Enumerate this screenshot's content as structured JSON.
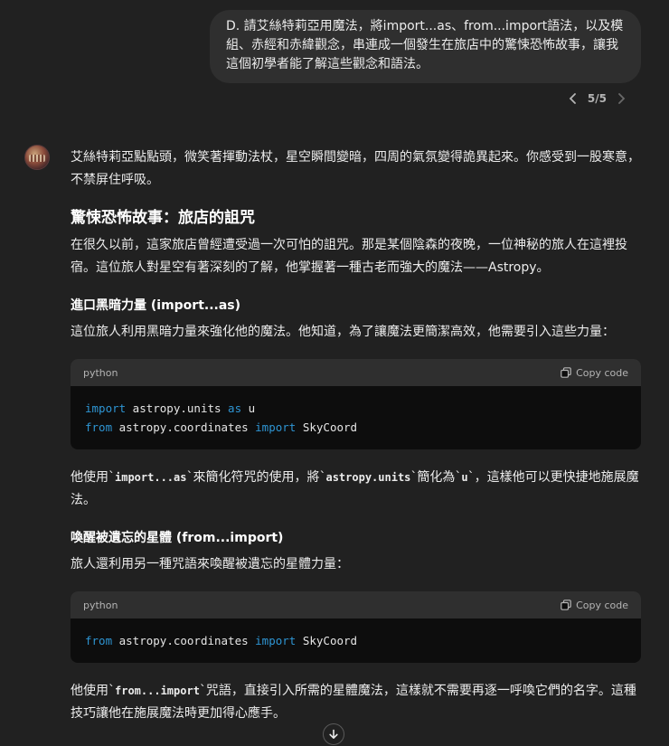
{
  "user_message": {
    "text": "D. 請艾絲特莉亞用魔法，將import...as、from...import語法，以及模組、赤經和赤緯觀念，串連成一個發生在旅店中的驚悚恐怖故事，讓我這個初學者能了解這些觀念和語法。"
  },
  "pager": {
    "label": "5/5"
  },
  "assistant": {
    "intro": "艾絲特莉亞點點頭，微笑著揮動法杖，星空瞬間變暗，四周的氣氛變得詭異起來。你感受到一股寒意，不禁屏住呼吸。",
    "title": "驚悚恐怖故事：旅店的詛咒",
    "para1": "在很久以前，這家旅店曾經遭受過一次可怕的詛咒。那是某個陰森的夜晚，一位神秘的旅人在這裡投宿。這位旅人對星空有著深刻的了解，他掌握著一種古老而強大的魔法——Astropy。",
    "section1": {
      "heading": "進口黑暗力量 (import...as)",
      "intro": "這位旅人利用黑暗力量來強化他的魔法。他知道，為了讓魔法更簡潔高效，他需要引入這些力量：",
      "code": {
        "lang": "python",
        "copy_label": "Copy code",
        "lines": [
          {
            "kw1": "import",
            "mid": " astropy.units ",
            "kw2": "as",
            "end": " u"
          },
          {
            "kw1": "from",
            "mid": " astropy.coordinates ",
            "kw2": "import",
            "end": " SkyCoord"
          }
        ]
      },
      "after": {
        "t1": "他使用`",
        "c1": "import...as",
        "t2": "`來簡化符咒的使用，將`",
        "c2": "astropy.units",
        "t3": "`簡化為`",
        "c3": "u",
        "t4": "`，這樣他可以更快捷地施展魔法。"
      }
    },
    "section2": {
      "heading": "喚醒被遺忘的星體 (from...import)",
      "intro": "旅人還利用另一種咒語來喚醒被遺忘的星體力量：",
      "code": {
        "lang": "python",
        "copy_label": "Copy code",
        "lines": [
          {
            "kw1": "from",
            "mid": " astropy.coordinates ",
            "kw2": "import",
            "end": " SkyCoord"
          }
        ]
      },
      "after": {
        "t1": "他使用`",
        "c1": "from...import",
        "t2": "`咒語，直接引入所需的星體魔法，這樣就不需要再逐一呼喚它們的名字。這種技巧讓他在施展魔法時更加得心應手。"
      }
    }
  },
  "icons": {
    "chevron_left": "chevron-left-icon",
    "chevron_right": "chevron-right-icon",
    "copy": "copy-icon",
    "scroll_down": "arrow-down-icon"
  },
  "colors": {
    "background": "#212121",
    "bubble": "#2f2f2f",
    "code_bg": "#0d0d0d",
    "keyword": "#2e95d3"
  }
}
